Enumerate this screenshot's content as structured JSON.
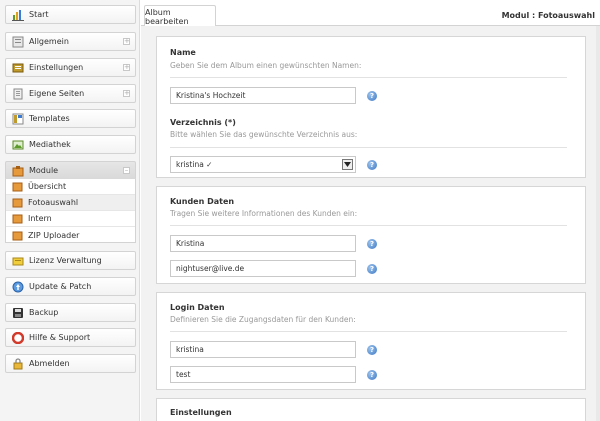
{
  "sidebar": {
    "items": [
      {
        "label": "Start",
        "icon": "chart-icon",
        "color": "#5b9b2a"
      },
      {
        "label": "Allgemein",
        "icon": "general-settings-icon",
        "color": "#8a8a8a",
        "expandable": true
      },
      {
        "label": "Einstellungen",
        "icon": "settings-icon",
        "color": "#c09a2a",
        "expandable": true
      },
      {
        "label": "Eigene Seiten",
        "icon": "pages-icon",
        "color": "#8a8a8a",
        "expandable": true
      },
      {
        "label": "Templates",
        "icon": "templates-icon",
        "color": "#c09a2a"
      },
      {
        "label": "Mediathek",
        "icon": "media-icon",
        "color": "#5b9b2a"
      },
      {
        "label": "Module",
        "icon": "module-icon",
        "color": "#d9822b",
        "expandable": true
      },
      {
        "label": "Lizenz Verwaltung",
        "icon": "license-icon",
        "color": "#d7b024"
      },
      {
        "label": "Update & Patch",
        "icon": "update-icon",
        "color": "#3a7bd5"
      },
      {
        "label": "Backup",
        "icon": "backup-icon",
        "color": "#333333"
      },
      {
        "label": "Hilfe & Support",
        "icon": "help-support-icon",
        "color": "#d23b2b"
      },
      {
        "label": "Abmelden",
        "icon": "logout-icon",
        "color": "#d7a124"
      }
    ],
    "module_subitems": [
      {
        "label": "Übersicht"
      },
      {
        "label": "Fotoauswahl"
      },
      {
        "label": "Intern"
      },
      {
        "label": "ZIP Uploader"
      }
    ]
  },
  "header": {
    "tab_label": "Album bearbeiten",
    "module_title": "Modul : Fotoauswahl"
  },
  "sections": {
    "name": {
      "title": "Name",
      "subtitle": "Geben Sie dem Album einen gewünschten Namen:",
      "value": "Kristina's Hochzeit",
      "folder_title": "Verzeichnis (*)",
      "folder_subtitle": "Bitte wählen Sie das gewünschte Verzeichnis aus:",
      "folder_value": "kristina ✓"
    },
    "kunden": {
      "title": "Kunden Daten",
      "subtitle": "Tragen Sie weitere Informationen des Kunden ein:",
      "name_value": "Kristina",
      "email_value": "nightuser@live.de"
    },
    "login": {
      "title": "Login Daten",
      "subtitle": "Definieren Sie die Zugangsdaten für den Kunden:",
      "user_value": "kristina",
      "password_value": "test"
    },
    "einstellungen": {
      "title": "Einstellungen"
    }
  },
  "help_glyph": "?",
  "colors": {
    "accent": "#3c78c2",
    "sidebar_bg": "#f4f4f4",
    "content_bg": "#f2f2f2"
  }
}
